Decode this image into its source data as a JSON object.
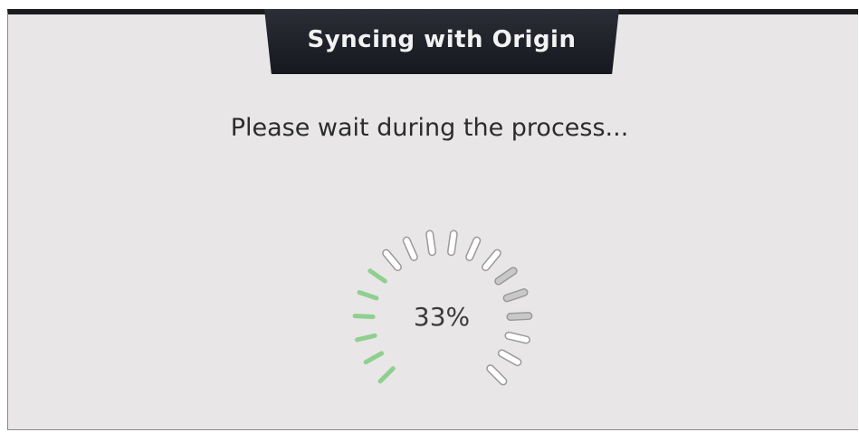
{
  "dialog": {
    "title": "Syncing with Origin",
    "message": "Please wait during the process..."
  },
  "progress": {
    "label": "33%",
    "value_percent": 33,
    "colors": {
      "done": "#8fcf8f",
      "pending_light": "#ffffff",
      "pending_dark": "#c8c8c8",
      "pending_outline": "#9a9a9a"
    }
  }
}
